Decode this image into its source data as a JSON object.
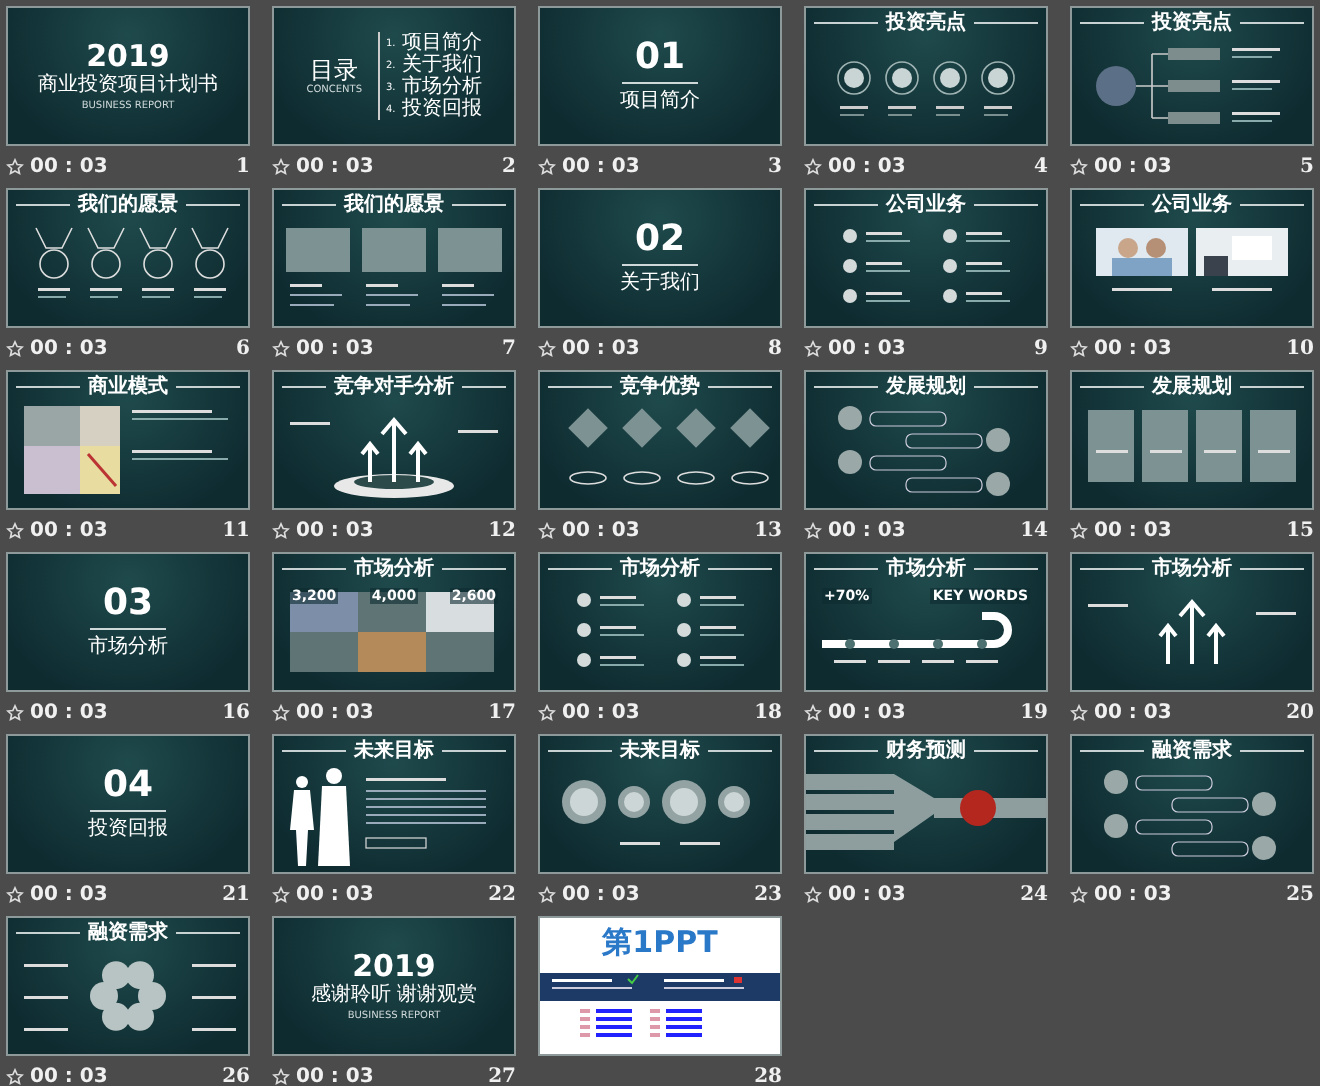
{
  "slides": [
    {
      "number": "1",
      "timing": "00 : 03",
      "kind": "cover",
      "year": "2019",
      "title": "商业投资项目计划书",
      "subtitle": "BUSINESS REPORT"
    },
    {
      "number": "2",
      "timing": "00 : 03",
      "kind": "toc",
      "title": "目录",
      "subtitle": "CONCENTS",
      "items": [
        {
          "index": "1.",
          "label": "项目简介"
        },
        {
          "index": "2.",
          "label": "关于我们"
        },
        {
          "index": "3.",
          "label": "市场分析"
        },
        {
          "index": "4.",
          "label": "投资回报"
        }
      ]
    },
    {
      "number": "3",
      "timing": "00 : 03",
      "kind": "section",
      "big": "01",
      "title": "项目简介"
    },
    {
      "number": "4",
      "timing": "00 : 03",
      "kind": "circles",
      "title": "投资亮点"
    },
    {
      "number": "5",
      "timing": "00 : 03",
      "kind": "tree",
      "title": "投资亮点"
    },
    {
      "number": "6",
      "timing": "00 : 03",
      "kind": "medals",
      "title": "我们的愿景"
    },
    {
      "number": "7",
      "timing": "00 : 03",
      "kind": "cards",
      "title": "我们的愿景"
    },
    {
      "number": "8",
      "timing": "00 : 03",
      "kind": "section",
      "big": "02",
      "title": "关于我们"
    },
    {
      "number": "9",
      "timing": "00 : 03",
      "kind": "list",
      "title": "公司业务"
    },
    {
      "number": "10",
      "timing": "00 : 03",
      "kind": "photos",
      "title": "公司业务"
    },
    {
      "number": "11",
      "timing": "00 : 03",
      "kind": "collage",
      "title": "商业模式"
    },
    {
      "number": "12",
      "timing": "00 : 03",
      "kind": "podium",
      "title": "竞争对手分析"
    },
    {
      "number": "13",
      "timing": "00 : 03",
      "kind": "diamonds",
      "title": "竞争优势"
    },
    {
      "number": "14",
      "timing": "00 : 03",
      "kind": "hexagons",
      "title": "发展规划"
    },
    {
      "number": "15",
      "timing": "00 : 03",
      "kind": "panels",
      "title": "发展规划"
    },
    {
      "number": "16",
      "timing": "00 : 03",
      "kind": "section",
      "big": "03",
      "title": "市场分析"
    },
    {
      "number": "17",
      "timing": "00 : 03",
      "kind": "grid",
      "title": "市场分析",
      "stats": [
        "3,200",
        "4,000",
        "2,600"
      ]
    },
    {
      "number": "18",
      "timing": "00 : 03",
      "kind": "list",
      "title": "市场分析"
    },
    {
      "number": "19",
      "timing": "00 : 03",
      "kind": "road",
      "title": "市场分析",
      "stats": [
        "+70%",
        "KEY WORDS"
      ]
    },
    {
      "number": "20",
      "timing": "00 : 03",
      "kind": "arrows",
      "title": "市场分析"
    },
    {
      "number": "21",
      "timing": "00 : 03",
      "kind": "section",
      "big": "04",
      "title": "投资回报"
    },
    {
      "number": "22",
      "timing": "00 : 03",
      "kind": "figures",
      "title": "未来目标"
    },
    {
      "number": "23",
      "timing": "00 : 03",
      "kind": "gears",
      "title": "未来目标"
    },
    {
      "number": "24",
      "timing": "00 : 03",
      "kind": "funnel",
      "title": "财务预测"
    },
    {
      "number": "25",
      "timing": "00 : 03",
      "kind": "hexagons",
      "title": "融资需求"
    },
    {
      "number": "26",
      "timing": "00 : 03",
      "kind": "flower",
      "title": "融资需求"
    },
    {
      "number": "27",
      "timing": "00 : 03",
      "kind": "cover",
      "year": "2019",
      "title": "感谢聆听 谢谢观赏",
      "subtitle": "BUSINESS REPORT"
    },
    {
      "number": "28",
      "kind": "ad",
      "logo": "第1PPT"
    }
  ]
}
